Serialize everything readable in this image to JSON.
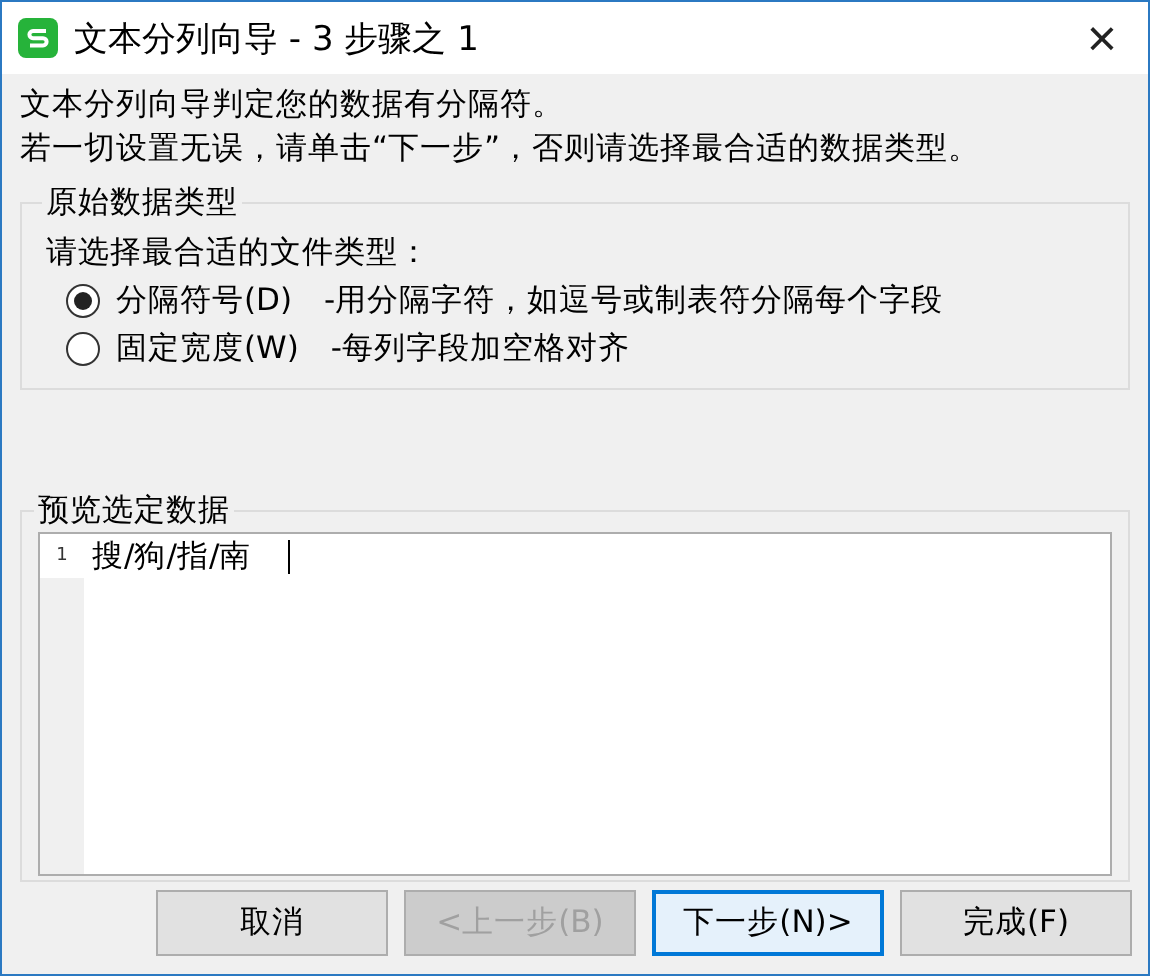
{
  "window": {
    "title": "文本分列向导 - 3 步骤之 1",
    "close": "×"
  },
  "intro": [
    "文本分列向导判定您的数据有分隔符。",
    "若一切设置无误，请单击“下一步”，否则请选择最合适的数据类型。"
  ],
  "data_type": {
    "legend": "原始数据类型",
    "prompt": "请选择最合适的文件类型：",
    "options": [
      {
        "label": "分隔符号(D)",
        "description": "-用分隔字符，如逗号或制表符分隔每个字段",
        "selected": true
      },
      {
        "label": "固定宽度(W)",
        "description": "-每列字段加空格对齐",
        "selected": false
      }
    ]
  },
  "preview": {
    "legend": "预览选定数据",
    "rows": [
      {
        "number": "1",
        "text": "搜/狗/指/南"
      }
    ]
  },
  "buttons": [
    {
      "label": "取消",
      "disabled": false,
      "focused": false
    },
    {
      "label": "<上一步(B)",
      "disabled": true,
      "focused": false
    },
    {
      "label": "下一步(N)>",
      "disabled": false,
      "focused": true
    },
    {
      "label": "完成(F)",
      "disabled": false,
      "focused": false
    }
  ]
}
